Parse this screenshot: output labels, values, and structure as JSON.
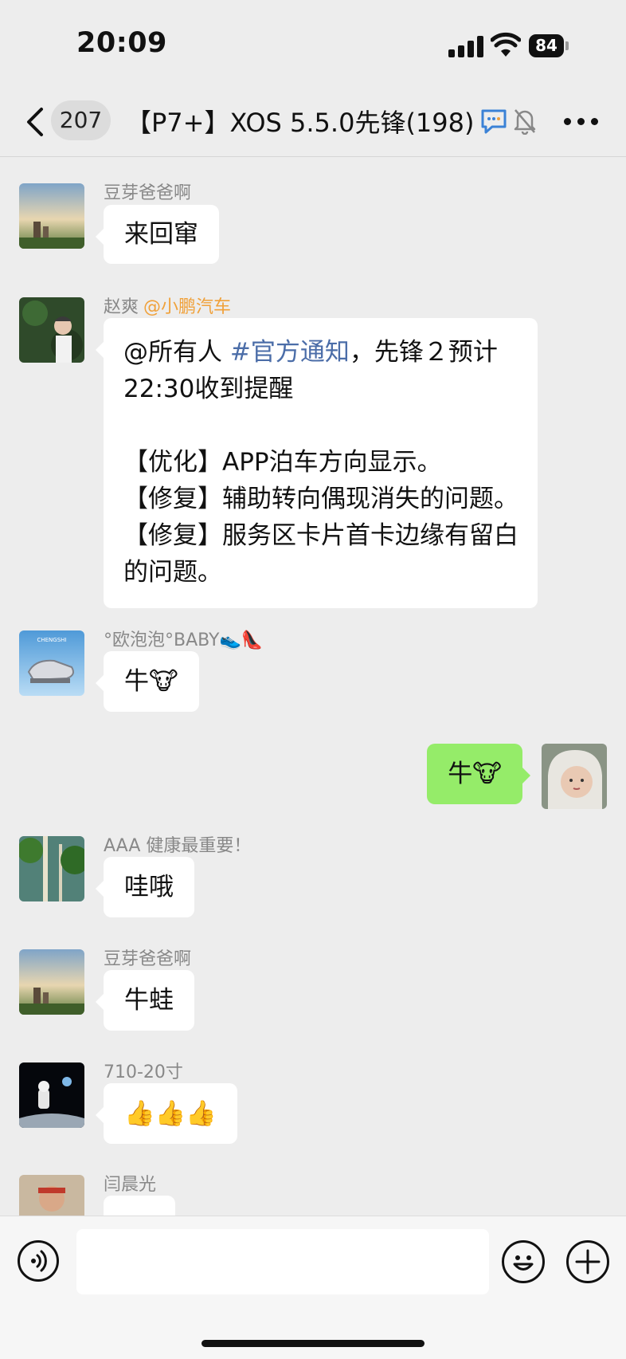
{
  "status_bar": {
    "time": "20:09",
    "battery": "84"
  },
  "header": {
    "unread_count": "207",
    "title": "【P7+】XOS 5.5.0先锋(198)",
    "icons": [
      "back-icon",
      "chat-bubble-icon",
      "mute-bell-icon",
      "more-icon"
    ]
  },
  "messages": [
    {
      "sender": "豆芽爸爸啊",
      "text": "来回窜",
      "avatar": "building-sunset-avatar"
    },
    {
      "sender": "赵爽",
      "tag": "@小鹏汽车",
      "line1_a": "@所有人 ",
      "line1_hash": "#官方通知",
      "line1_b": "，先锋２预计22:30收到提醒",
      "p1": "【优化】APP泊车方向显示。",
      "p2": "【修复】辅助转向偶现消失的问题。",
      "p3": "【修复】服务区卡片首卡边缘有留白的问题。",
      "avatar": "woman-forest-avatar"
    },
    {
      "sender": "°欧泡泡°BABY👟👠",
      "text": "牛🐮",
      "avatar": "sneaker-avatar"
    },
    {
      "text": "牛🐮",
      "mine": true,
      "avatar": "baby-avatar"
    },
    {
      "sender": "AAA 健康最重要！",
      "text": "哇哦",
      "avatar": "forest-avatar"
    },
    {
      "sender": "豆芽爸爸啊",
      "text": "牛蛙",
      "avatar": "building-sunset-avatar"
    },
    {
      "sender": "710-20寸",
      "text": "👍👍👍",
      "avatar": "astronaut-avatar"
    },
    {
      "sender": "闫晨光",
      "text": "",
      "avatar": "man-avatar"
    }
  ],
  "colors": {
    "background": "#ededed",
    "bubble": "#ffffff",
    "my_bubble": "#95ec69",
    "tag": "#f0a13a",
    "hashtag": "#4b6da8"
  },
  "input_bar": {
    "icons": [
      "voice-icon",
      "emoji-icon",
      "plus-icon"
    ]
  }
}
